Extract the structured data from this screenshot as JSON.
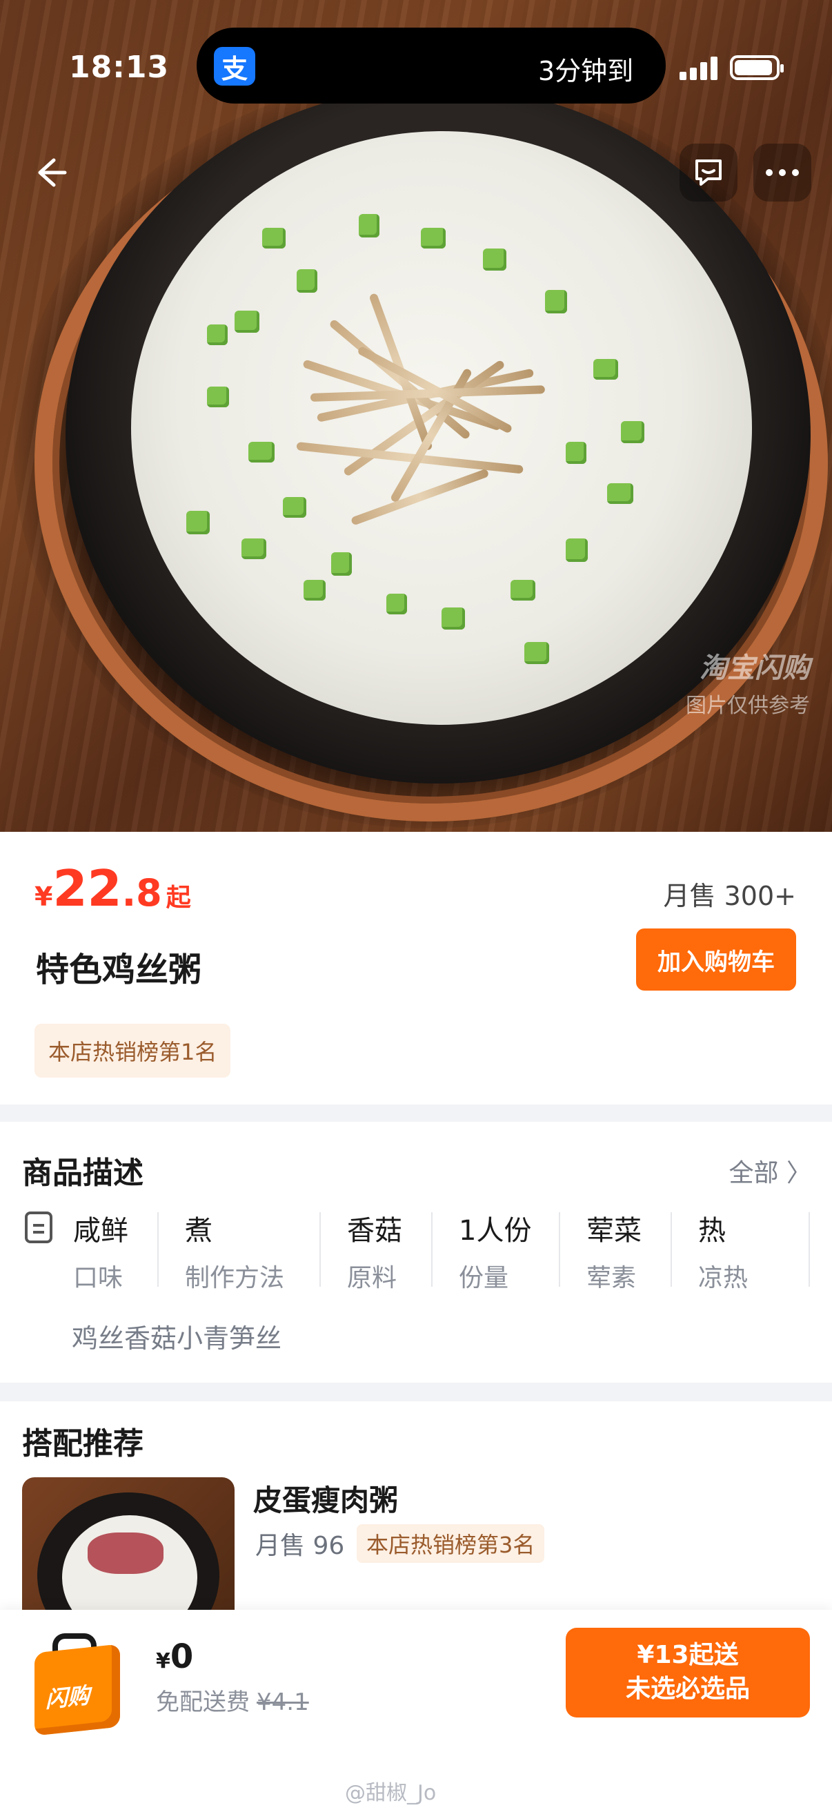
{
  "status_bar": {
    "time": "18:13",
    "island_app_icon": "支",
    "island_text": "3分钟到"
  },
  "nav": {
    "back_icon": "back-arrow-icon",
    "message_icon": "message-icon",
    "more_icon": "more-icon"
  },
  "hero": {
    "watermark_line1": "淘宝闪购",
    "watermark_line2": "图片仅供参考"
  },
  "product": {
    "price_currency": "¥",
    "price_integer": "22",
    "price_decimal": ".8",
    "price_suffix": "起",
    "monthly_sales": "月售 300+",
    "name": "特色鸡丝粥",
    "add_to_cart": "加入购物车",
    "rank_badge": "本店热销榜第1名"
  },
  "description": {
    "title": "商品描述",
    "all_link": "全部 〉",
    "attributes": [
      {
        "value": "咸鲜",
        "key": "口味"
      },
      {
        "value": "煮",
        "key": "制作方法"
      },
      {
        "value": "香菇",
        "key": "原料"
      },
      {
        "value": "1人份",
        "key": "份量"
      },
      {
        "value": "荤菜",
        "key": "荤素"
      },
      {
        "value": "热",
        "key": "凉热"
      }
    ],
    "text": "鸡丝香菇小青笋丝"
  },
  "recommendation": {
    "title": "搭配推荐",
    "item": {
      "name": "皮蛋瘦肉粥",
      "sales": "月售 96",
      "rank_badge": "本店热销榜第3名"
    }
  },
  "bottom_bar": {
    "brand_label": "闪购",
    "fee_currency": "¥",
    "fee_amount": "0",
    "fee_label": "免配送费",
    "fee_original": "¥4.1",
    "checkout_line1": "¥13起送",
    "checkout_line2": "未选必选品"
  },
  "watermark_credit": "@甜椒_Jo",
  "colors": {
    "accent_orange": "#ff6a0a",
    "price_red": "#ff3a22",
    "badge_bg": "#fdf0e4",
    "badge_text": "#9a5b2c"
  }
}
